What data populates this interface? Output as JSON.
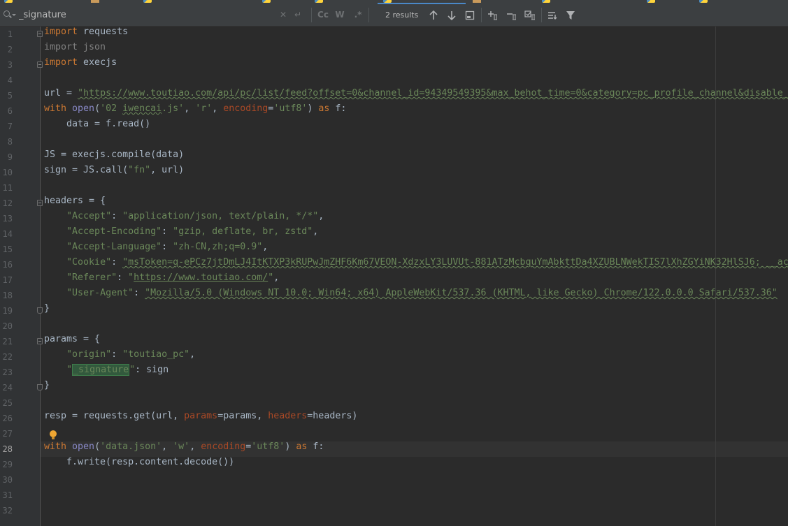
{
  "search": {
    "query": "_signature",
    "match_case_label": "Cc",
    "words_label": "W",
    "regex_label": ".*",
    "results": "2 results"
  },
  "editor": {
    "lines": [
      {
        "n": "1",
        "tokens": [
          [
            "k",
            "import"
          ],
          [
            "",
            "requests"
          ]
        ]
      },
      {
        "n": "2",
        "tokens": [
          [
            "g",
            "import json"
          ]
        ]
      },
      {
        "n": "3",
        "tokens": [
          [
            "k",
            "import"
          ],
          [
            "",
            "execjs"
          ]
        ]
      },
      {
        "n": "4",
        "tokens": []
      },
      {
        "n": "5",
        "tokens": [
          [
            "",
            "url = "
          ],
          [
            "s w",
            "\"https://www.toutiao.com/api/pc/list/feed?offset=0&channel_id=94349549395&max_behot_time=0&category=pc_profile_channel&disable_"
          ]
        ]
      },
      {
        "n": "6",
        "tokens": [
          [
            "k",
            "with"
          ],
          [
            "bi",
            "open"
          ],
          [
            "",
            "("
          ],
          [
            "s",
            "'02 "
          ],
          [
            "s w",
            "iwencai"
          ],
          [
            "s",
            ".js'"
          ],
          [
            "",
            ", "
          ],
          [
            "s",
            "'r'"
          ],
          [
            "",
            ", "
          ],
          [
            "p",
            "encoding"
          ],
          [
            "",
            "="
          ],
          [
            "s",
            "'utf8'"
          ],
          [
            "",
            ") "
          ],
          [
            "k",
            "as"
          ],
          [
            "",
            " f:"
          ]
        ]
      },
      {
        "n": "7",
        "tokens": [
          [
            "",
            "    data = f.read()"
          ]
        ]
      },
      {
        "n": "8",
        "tokens": []
      },
      {
        "n": "9",
        "tokens": [
          [
            "",
            "JS = execjs.compile(data)"
          ]
        ]
      },
      {
        "n": "10",
        "tokens": [
          [
            "",
            "sign = JS.call("
          ],
          [
            "s",
            "\"fn\""
          ],
          [
            "",
            ", url)"
          ]
        ]
      },
      {
        "n": "11",
        "tokens": []
      },
      {
        "n": "12",
        "tokens": [
          [
            "",
            "headers = {"
          ]
        ]
      },
      {
        "n": "13",
        "tokens": [
          [
            "",
            "    "
          ],
          [
            "s",
            "\"Accept\""
          ],
          [
            "",
            ": "
          ],
          [
            "s",
            "\"application/json, text/plain, */*\""
          ],
          [
            "",
            ","
          ]
        ]
      },
      {
        "n": "14",
        "tokens": [
          [
            "",
            "    "
          ],
          [
            "s",
            "\"Accept-Encoding\""
          ],
          [
            "",
            ": "
          ],
          [
            "s",
            "\"gzip, deflate, br, zstd\""
          ],
          [
            "",
            ","
          ]
        ]
      },
      {
        "n": "15",
        "tokens": [
          [
            "",
            "    "
          ],
          [
            "s",
            "\"Accept-Language\""
          ],
          [
            "",
            ": "
          ],
          [
            "s",
            "\"zh-CN,zh;q=0.9\""
          ],
          [
            "",
            ","
          ]
        ]
      },
      {
        "n": "16",
        "tokens": [
          [
            "",
            "    "
          ],
          [
            "s",
            "\"Cookie\""
          ],
          [
            "",
            ": "
          ],
          [
            "s w",
            "\"msToken=q-ePCz7jtDmLJ4ItKTXP3kRUPwJmZHF6Km67VEON-XdzxLY3LUVUt-881ATzMcbquYmAbkttDa4XZUBLNWekTIS7lXhZGYiNK32HlSJ6; __ac"
          ]
        ]
      },
      {
        "n": "17",
        "tokens": [
          [
            "",
            "    "
          ],
          [
            "s",
            "\"Referer\""
          ],
          [
            "",
            ": "
          ],
          [
            "s",
            "\""
          ],
          [
            "s u",
            "https://www.toutiao.com/"
          ],
          [
            "s",
            "\""
          ],
          [
            "",
            ","
          ]
        ]
      },
      {
        "n": "18",
        "tokens": [
          [
            "",
            "    "
          ],
          [
            "s",
            "\"User-Agent\""
          ],
          [
            "",
            ": "
          ],
          [
            "s w",
            "\"Mozilla/5.0 (Windows NT 10.0; Win64; x64) AppleWebKit/537.36 (KHTML, like Gecko) Chrome/122.0.0.0 Safari/537.36\""
          ]
        ]
      },
      {
        "n": "19",
        "tokens": [
          [
            "",
            "}"
          ]
        ]
      },
      {
        "n": "20",
        "tokens": []
      },
      {
        "n": "21",
        "tokens": [
          [
            "",
            "params = {"
          ]
        ]
      },
      {
        "n": "22",
        "tokens": [
          [
            "",
            "    "
          ],
          [
            "s",
            "\"origin\""
          ],
          [
            "",
            ": "
          ],
          [
            "s",
            "\"toutiao_pc\""
          ],
          [
            "",
            ","
          ]
        ]
      },
      {
        "n": "23",
        "tokens": [
          [
            "",
            "    "
          ],
          [
            "s",
            "\""
          ],
          [
            "s hl",
            "_signature"
          ],
          [
            "s",
            "\""
          ],
          [
            "",
            ": sign"
          ]
        ]
      },
      {
        "n": "24",
        "tokens": [
          [
            "",
            "}"
          ]
        ]
      },
      {
        "n": "25",
        "tokens": []
      },
      {
        "n": "26",
        "tokens": [
          [
            "",
            "resp = requests.get(url, "
          ],
          [
            "p",
            "params"
          ],
          [
            "",
            "=params, "
          ],
          [
            "p",
            "headers"
          ],
          [
            "",
            "=headers)"
          ]
        ]
      },
      {
        "n": "27",
        "tokens": []
      },
      {
        "n": "28",
        "tokens": [
          [
            "k",
            "with"
          ],
          [
            "bi",
            "open"
          ],
          [
            "",
            "("
          ],
          [
            "s",
            "'data.json'"
          ],
          [
            "",
            ", "
          ],
          [
            "s",
            "'w'"
          ],
          [
            "",
            ", "
          ],
          [
            "p",
            "encoding"
          ],
          [
            "",
            "="
          ],
          [
            "s",
            "'utf8'"
          ],
          [
            "",
            ") "
          ],
          [
            "k",
            "as"
          ],
          [
            "",
            " f:"
          ]
        ]
      },
      {
        "n": "29",
        "tokens": [
          [
            "",
            "    f.write(resp.content.decode())"
          ]
        ]
      },
      {
        "n": "30",
        "tokens": []
      },
      {
        "n": "31",
        "tokens": []
      },
      {
        "n": "32",
        "tokens": []
      }
    ],
    "current_line": "28"
  },
  "colors": {
    "background": "#2b2b2b",
    "keyword": "#cc7832",
    "string": "#6a8759",
    "builtin": "#8888c6",
    "param": "#aa4926",
    "search_highlight": "#32593d"
  }
}
